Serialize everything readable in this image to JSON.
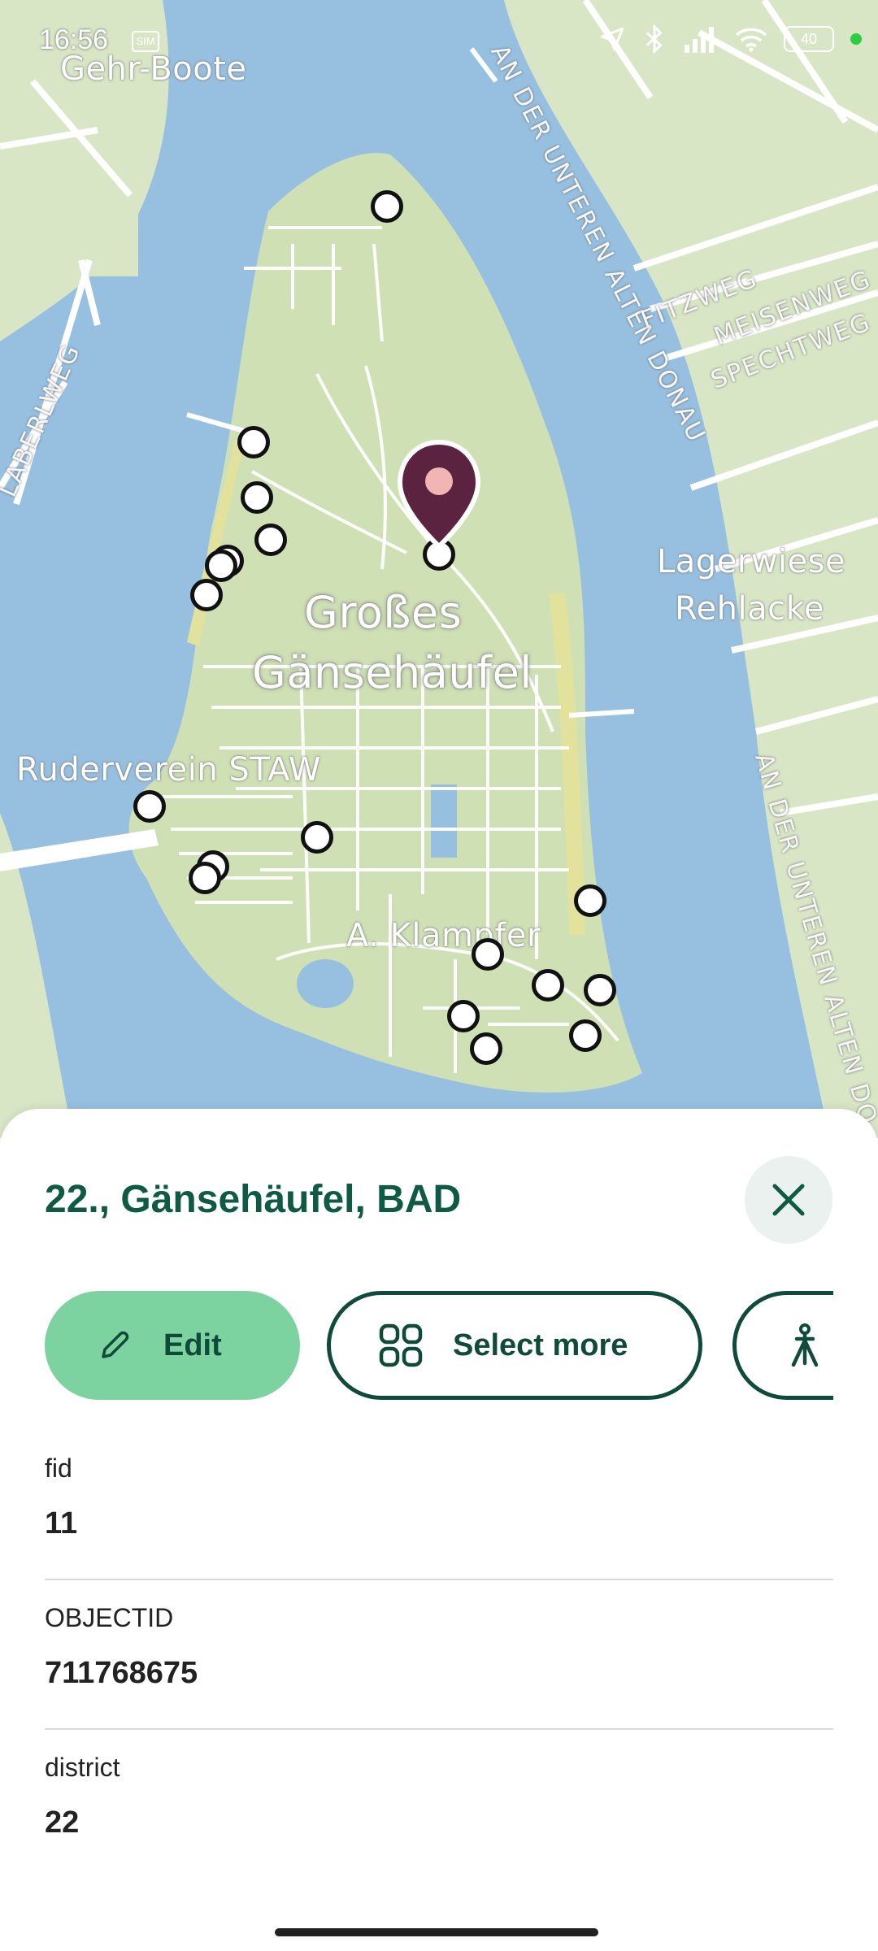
{
  "status_bar": {
    "time": "16:56",
    "sim": "SIM",
    "battery": "40"
  },
  "map": {
    "place_labels": {
      "gehr_boote": "Gehr-Boote",
      "island_line1": "Großes",
      "island_line2": "Gänsehäufel",
      "lagerwiese_line1": "Lagerwiese",
      "lagerwiese_line2": "Rehlacke",
      "ruderverein": "Ruderverein STAW",
      "klampfer": "A. Klampfer"
    },
    "road_labels": {
      "alte_donau_top": "AN DER UNTEREN ALTEN DONAU",
      "alte_donau_right": "AN DER UNTEREN ALTEN DO",
      "fitzweg": "FITZWEG",
      "meisenweg": "MEISENWEG",
      "spechtweg": "SPECHTWEG",
      "laberlweg": "LABERLWEG"
    },
    "colors": {
      "water": "#97c0e0",
      "land": "#d8e6c6",
      "island": "#cfe0b5",
      "beach": "#e2e29c",
      "road": "#ffffff",
      "pin": "#5b2340",
      "pin_center": "#f1b5b3"
    }
  },
  "feature_panel": {
    "title": "22., Gänsehäufel, BAD",
    "close_icon": "close-icon",
    "actions": {
      "edit_label": "Edit",
      "select_more_label": "Select more",
      "survey_icon": "survey-tripod-icon"
    },
    "fields": [
      {
        "name": "fid",
        "value": "11"
      },
      {
        "name": "OBJECTID",
        "value": "711768675"
      },
      {
        "name": "district",
        "value": "22"
      }
    ]
  }
}
